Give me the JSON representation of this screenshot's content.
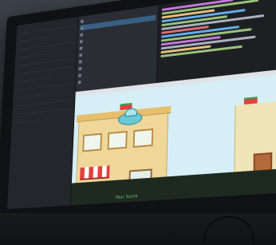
{
  "scene": {
    "description_colors": {
      "monitor_bezel": "#0f1114",
      "editor_bg": "#1e1f23",
      "game_sky": "#d6eef6",
      "hazard_yellow": "#f2d43a",
      "caption_green": "#6fd488"
    }
  },
  "game_view": {
    "caption": "Your Score"
  },
  "icons": {
    "ufo": "ufo-sprite",
    "hero": "player-sprite",
    "flag": "flag-sprite"
  }
}
